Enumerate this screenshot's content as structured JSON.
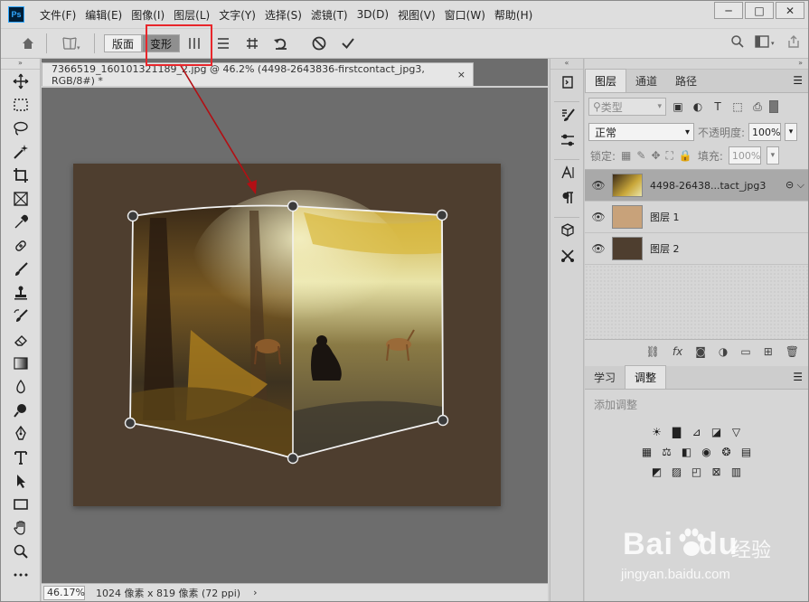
{
  "menubar": {
    "logo": "Ps",
    "items": [
      "文件(F)",
      "编辑(E)",
      "图像(I)",
      "图层(L)",
      "文字(Y)",
      "选择(S)",
      "滤镜(T)",
      "3D(D)",
      "视图(V)",
      "窗口(W)",
      "帮助(H)"
    ],
    "window_controls": [
      "─",
      "□",
      "✕"
    ]
  },
  "options": {
    "layout_label": "版面",
    "transform_label": "变形"
  },
  "document": {
    "tab_title": "7366519_160101321189_2.jpg @ 46.2% (4498-2643836-firstcontact_jpg3, RGB/8#) *",
    "tab_close": "×",
    "zoom": "46.17%",
    "doc_info": "1024 像素 x 819 像素 (72 ppi)",
    "status_arrow": "›"
  },
  "layers_panel": {
    "tabs": [
      "图层",
      "通道",
      "路径"
    ],
    "filter_placeholder": "类型",
    "blend_mode": "正常",
    "opacity_label": "不透明度:",
    "opacity_value": "100%",
    "lock_label": "锁定:",
    "fill_label": "填充:",
    "fill_value": "100%",
    "layers": [
      {
        "name": "4498-26438...tact_jpg3",
        "thumb_color": "#7a6d3c",
        "selected": true
      },
      {
        "name": "图层 1",
        "thumb_color": "#c8a27a",
        "selected": false
      },
      {
        "name": "图层 2",
        "thumb_color": "#4e3e2f",
        "selected": false
      }
    ]
  },
  "adjust_panel": {
    "tabs": [
      "学习",
      "调整"
    ],
    "title": "添加调整"
  },
  "watermark": {
    "brand": "Bai",
    "brand2": "du",
    "cn": "经验",
    "url": "jingyan.baidu.com"
  },
  "colors": {
    "canvas": "#4e3e2f",
    "highlight": "#e8262b",
    "arrow": "#b30f14"
  }
}
